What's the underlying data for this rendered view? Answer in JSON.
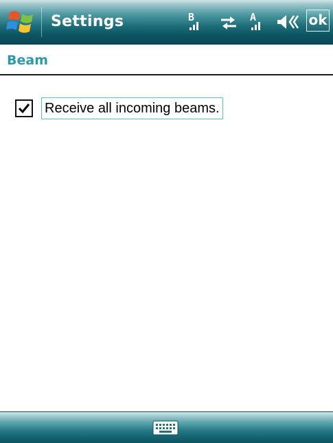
{
  "titlebar": {
    "app_title": "Settings",
    "ok_label": "ok",
    "status_icons": [
      "start-windows-icon",
      "signal-b-icon",
      "connectivity-arrows-icon",
      "signal-a-icon",
      "speaker-volume-icon"
    ]
  },
  "page": {
    "title": "Beam"
  },
  "options": {
    "receive_beams": {
      "label": "Receive all incoming beams.",
      "checked": true
    }
  },
  "menubar": {
    "center_icon": "keyboard-icon"
  },
  "colors": {
    "titlebar_dark": "#0d5462",
    "title_accent": "#2f98a8",
    "focus_border": "#5fb8c4"
  }
}
